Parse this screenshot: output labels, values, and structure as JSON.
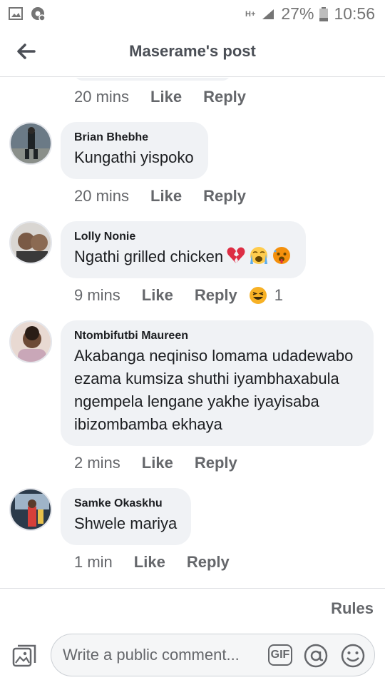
{
  "status": {
    "battery": "27%",
    "time": "10:56",
    "network": "H+"
  },
  "header": {
    "title": "Maserame's post"
  },
  "comments": [
    {
      "author": "",
      "text": "",
      "time": "20 mins",
      "like": "Like",
      "reply": "Reply"
    },
    {
      "author": "Brian Bhebhe",
      "text": "Kungathi yispoko",
      "time": "20 mins",
      "like": "Like",
      "reply": "Reply"
    },
    {
      "author": "Lolly Nonie",
      "text": "Ngathi grilled chicken",
      "time": "9 mins",
      "like": "Like",
      "reply": "Reply",
      "reaction_count": "1"
    },
    {
      "author": "Ntombifutbi Maureen",
      "text": "Akabanga neqiniso lomama udadewabo ezama kumsiza shuthi iyambhaxabula ngempela lengane yakhe iyayisaba ibizombamba ekhaya",
      "time": "2 mins",
      "like": "Like",
      "reply": "Reply"
    },
    {
      "author": "Samke Okaskhu",
      "text": "Shwele mariya",
      "time": "1 min",
      "like": "Like",
      "reply": "Reply"
    }
  ],
  "footer": {
    "rules": "Rules",
    "placeholder": "Write a public comment...",
    "gif": "GIF"
  }
}
